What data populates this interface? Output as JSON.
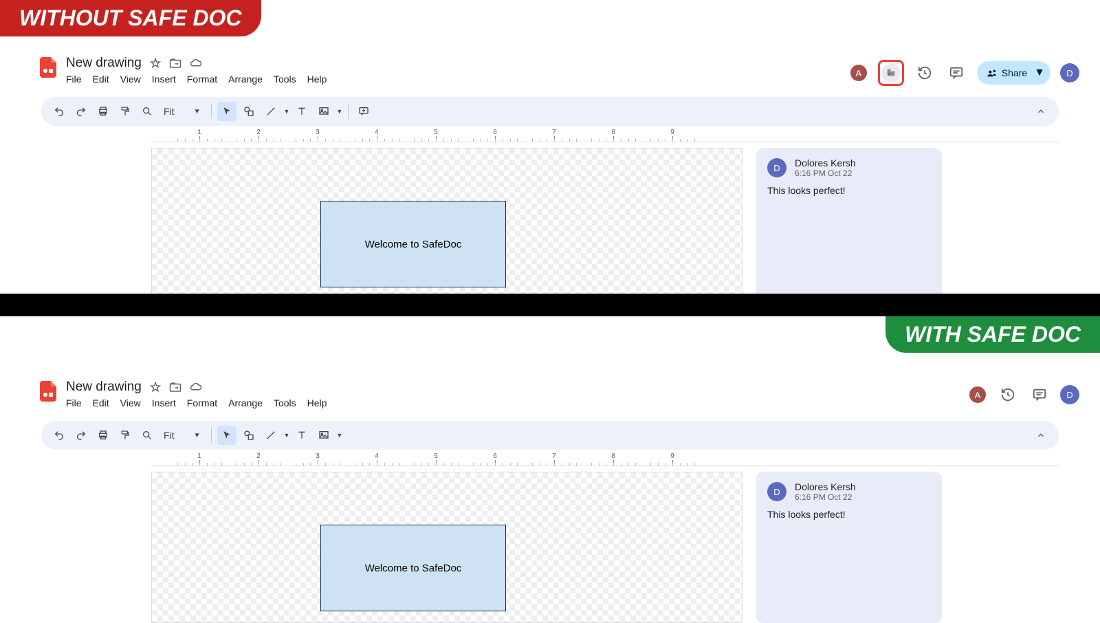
{
  "badges": {
    "without": "WITHOUT SAFE DOC",
    "with": "WITH SAFE DOC"
  },
  "doc": {
    "title": "New drawing"
  },
  "menus": {
    "file": "File",
    "edit": "Edit",
    "view": "View",
    "insert": "Insert",
    "format": "Format",
    "arrange": "Arrange",
    "tools": "Tools",
    "help": "Help"
  },
  "toolbar": {
    "zoom": "Fit"
  },
  "shape": {
    "text": "Welcome to SafeDoc"
  },
  "share": {
    "label": "Share"
  },
  "avatars": {
    "collab": "A",
    "user": "D"
  },
  "comment": {
    "author_initial": "D",
    "author": "Dolores Kersh",
    "time": "6:16 PM Oct 22",
    "body": "This looks perfect!"
  },
  "ruler_marks": [
    "1",
    "2",
    "3",
    "4",
    "5",
    "6",
    "7",
    "8",
    "9"
  ]
}
